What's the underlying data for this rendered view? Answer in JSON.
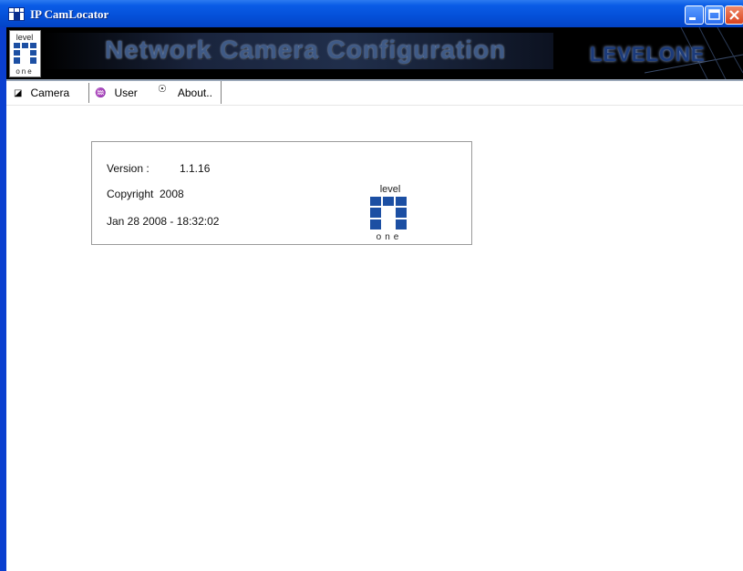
{
  "window": {
    "title": "IP CamLocator",
    "icon": "app-grid-icon",
    "controls": [
      "minimize-icon",
      "maximize-icon",
      "close-icon"
    ]
  },
  "banner": {
    "logo_top": "level",
    "logo_bottom": "one",
    "title": "Network Camera Configuration",
    "brand": "LEVELONE"
  },
  "tabs": [
    {
      "label": "Camera",
      "icon": "camera-icon"
    },
    {
      "label": "User",
      "icon": "user-icon"
    },
    {
      "label": "About..",
      "icon": "info-icon",
      "selected": true
    }
  ],
  "about": {
    "version_label": "Version :",
    "version_value": "1.1.16",
    "copyright_label": "Copyright",
    "copyright_year": "2008",
    "build_date": "Jan 28 2008 - 18:32:02",
    "logo_top": "level",
    "logo_bottom": "one"
  },
  "colors": {
    "titlebar": "#0450d8",
    "logo_blue": "#1c4fa3",
    "banner_bg": "#000000"
  }
}
